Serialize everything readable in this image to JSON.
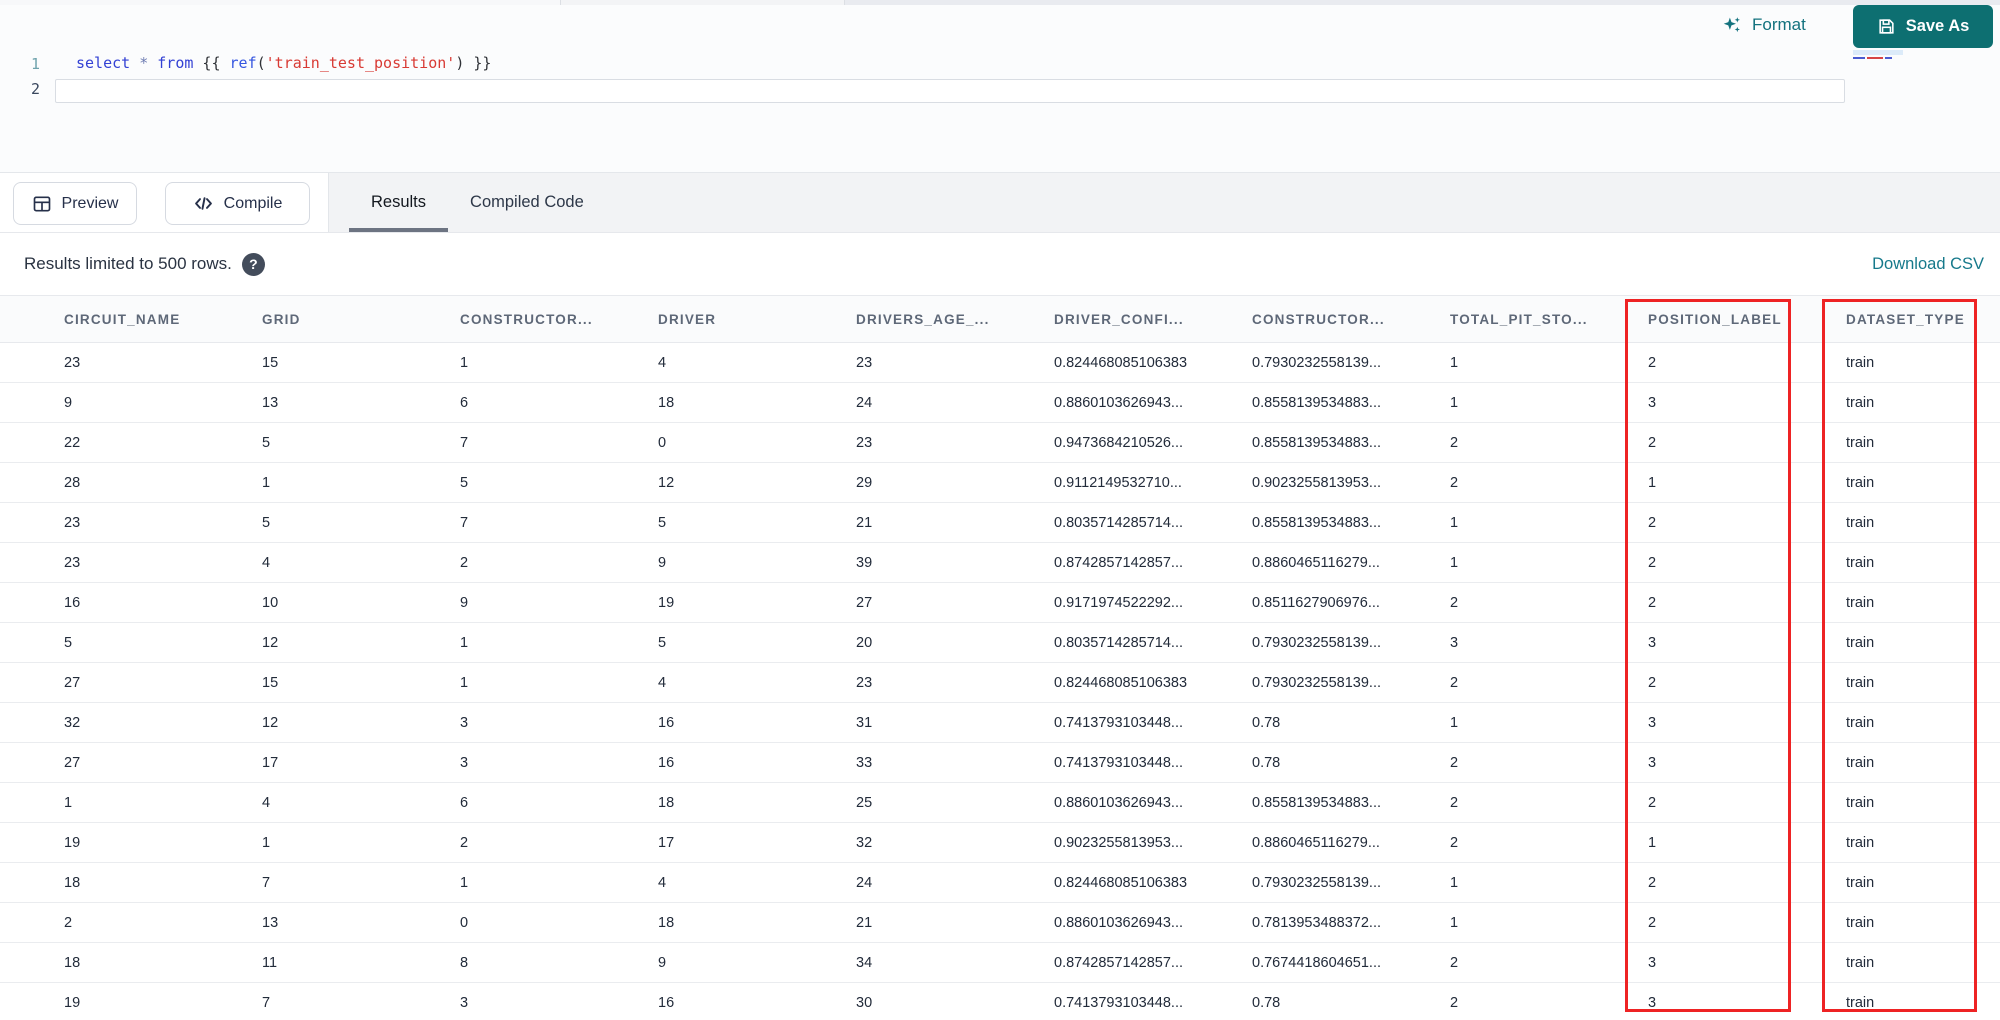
{
  "colors": {
    "accent_teal": "#0d6f71",
    "link_teal": "#16798b",
    "annotation_red": "#ee2324",
    "keyword_blue": "#3341d4",
    "string_red": "#d83a34"
  },
  "editor": {
    "line_numbers": [
      "1",
      "2"
    ],
    "code_tokens": [
      {
        "text": "select",
        "type": "keyword"
      },
      {
        "text": " ",
        "type": "plain"
      },
      {
        "text": "*",
        "type": "operator"
      },
      {
        "text": " ",
        "type": "plain"
      },
      {
        "text": "from",
        "type": "keyword"
      },
      {
        "text": " {{ ",
        "type": "plain"
      },
      {
        "text": "ref",
        "type": "function"
      },
      {
        "text": "(",
        "type": "plain"
      },
      {
        "text": "'train_test_position'",
        "type": "string"
      },
      {
        "text": ")",
        "type": "plain"
      },
      {
        "text": " }}",
        "type": "plain"
      }
    ],
    "format_label": "Format",
    "save_as_label": "Save As"
  },
  "toolbar": {
    "preview_label": "Preview",
    "compile_label": "Compile",
    "tabs": [
      {
        "label": "Results",
        "active": true
      },
      {
        "label": "Compiled Code",
        "active": false
      }
    ]
  },
  "results": {
    "limit_message": "Results limited to 500 rows.",
    "help_glyph": "?",
    "download_label": "Download CSV"
  },
  "table": {
    "columns": [
      "CIRCUIT_NAME",
      "GRID",
      "CONSTRUCTOR...",
      "DRIVER",
      "DRIVERS_AGE_...",
      "DRIVER_CONFI...",
      "CONSTRUCTOR...",
      "TOTAL_PIT_STO...",
      "POSITION_LABEL",
      "DATASET_TYPE"
    ],
    "rows": [
      [
        "23",
        "15",
        "1",
        "4",
        "23",
        "0.824468085106383",
        "0.7930232558139...",
        "1",
        "2",
        "train"
      ],
      [
        "9",
        "13",
        "6",
        "18",
        "24",
        "0.8860103626943...",
        "0.8558139534883...",
        "1",
        "3",
        "train"
      ],
      [
        "22",
        "5",
        "7",
        "0",
        "23",
        "0.9473684210526...",
        "0.8558139534883...",
        "2",
        "2",
        "train"
      ],
      [
        "28",
        "1",
        "5",
        "12",
        "29",
        "0.9112149532710...",
        "0.9023255813953...",
        "2",
        "1",
        "train"
      ],
      [
        "23",
        "5",
        "7",
        "5",
        "21",
        "0.8035714285714...",
        "0.8558139534883...",
        "1",
        "2",
        "train"
      ],
      [
        "23",
        "4",
        "2",
        "9",
        "39",
        "0.8742857142857...",
        "0.8860465116279...",
        "1",
        "2",
        "train"
      ],
      [
        "16",
        "10",
        "9",
        "19",
        "27",
        "0.9171974522292...",
        "0.8511627906976...",
        "2",
        "2",
        "train"
      ],
      [
        "5",
        "12",
        "1",
        "5",
        "20",
        "0.8035714285714...",
        "0.7930232558139...",
        "3",
        "3",
        "train"
      ],
      [
        "27",
        "15",
        "1",
        "4",
        "23",
        "0.824468085106383",
        "0.7930232558139...",
        "2",
        "2",
        "train"
      ],
      [
        "32",
        "12",
        "3",
        "16",
        "31",
        "0.7413793103448...",
        "0.78",
        "1",
        "3",
        "train"
      ],
      [
        "27",
        "17",
        "3",
        "16",
        "33",
        "0.7413793103448...",
        "0.78",
        "2",
        "3",
        "train"
      ],
      [
        "1",
        "4",
        "6",
        "18",
        "25",
        "0.8860103626943...",
        "0.8558139534883...",
        "2",
        "2",
        "train"
      ],
      [
        "19",
        "1",
        "2",
        "17",
        "32",
        "0.9023255813953...",
        "0.8860465116279...",
        "2",
        "1",
        "train"
      ],
      [
        "18",
        "7",
        "1",
        "4",
        "24",
        "0.824468085106383",
        "0.7930232558139...",
        "1",
        "2",
        "train"
      ],
      [
        "2",
        "13",
        "0",
        "18",
        "21",
        "0.8860103626943...",
        "0.7813953488372...",
        "1",
        "2",
        "train"
      ],
      [
        "18",
        "11",
        "8",
        "9",
        "34",
        "0.8742857142857...",
        "0.7674418604651...",
        "2",
        "3",
        "train"
      ],
      [
        "19",
        "7",
        "3",
        "16",
        "30",
        "0.7413793103448...",
        "0.78",
        "2",
        "3",
        "train"
      ]
    ],
    "annotations": {
      "highlighted_columns": [
        "POSITION_LABEL",
        "DATASET_TYPE"
      ]
    }
  }
}
